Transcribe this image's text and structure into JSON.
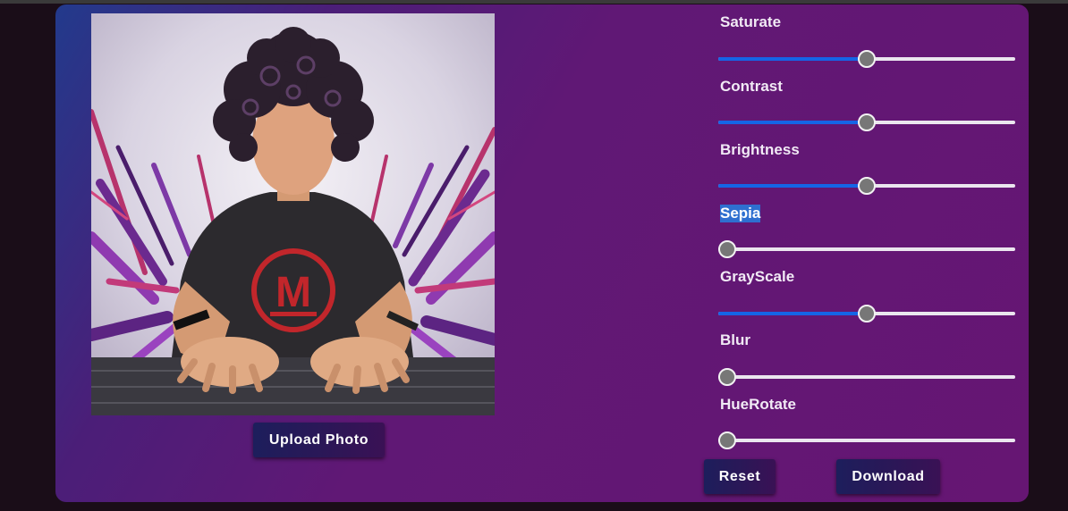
{
  "editor": {
    "upload_label": "Upload Photo",
    "reset_label": "Reset",
    "download_label": "Download",
    "photo_name": "profile-illustration",
    "logo_letter": "M"
  },
  "filters": [
    {
      "label": "Saturate",
      "value": 0.5
    },
    {
      "label": "Contrast",
      "value": 0.5
    },
    {
      "label": "Brightness",
      "value": 0.5
    },
    {
      "label": "Sepia",
      "value": 0,
      "selected": true
    },
    {
      "label": "GrayScale",
      "value": 0.5
    },
    {
      "label": "Blur",
      "value": 0
    },
    {
      "label": "HueRotate",
      "value": 0
    }
  ],
  "colors": {
    "accent": "#1565e6",
    "panel": "#661673",
    "button": "#2b1757"
  }
}
